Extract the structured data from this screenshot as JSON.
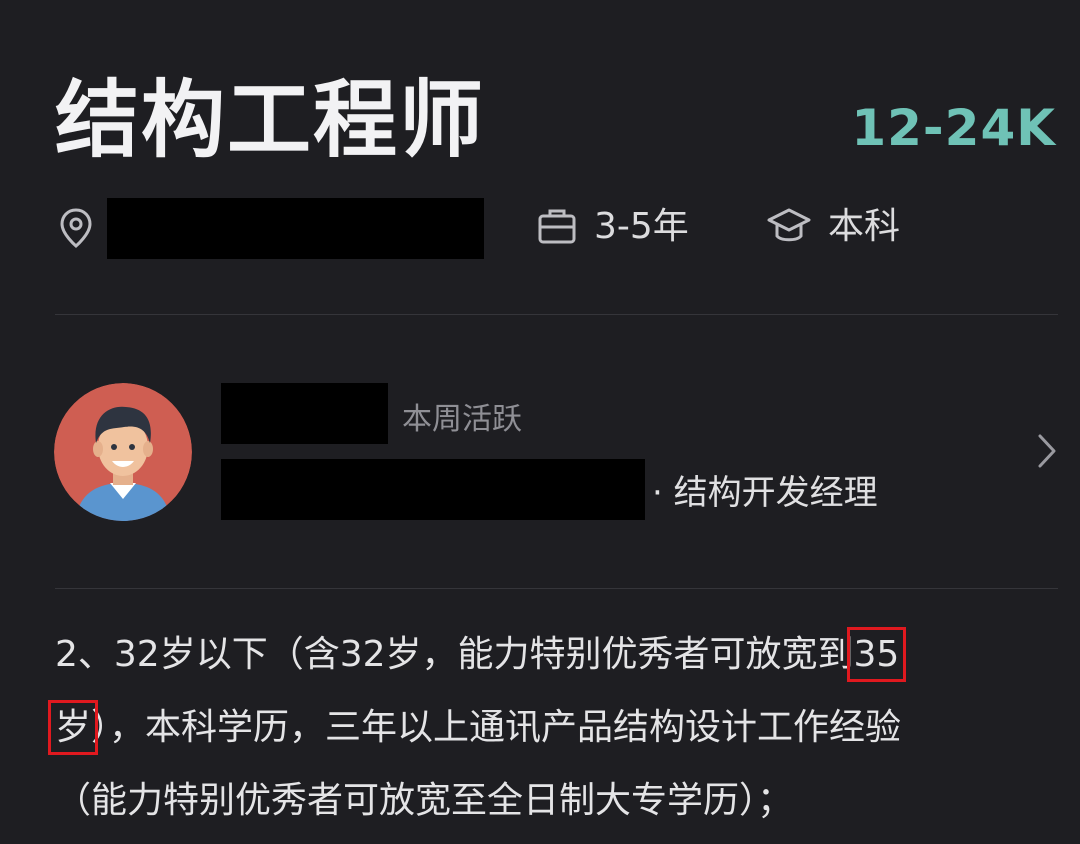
{
  "job": {
    "title": "结构工程师",
    "salary": "12-24K",
    "experience": "3-5年",
    "education": "本科"
  },
  "recruiter": {
    "status": "本周活跃",
    "position_suffix": "· 结构开发经理"
  },
  "description": {
    "line1_prefix": "2、32岁以下（含32岁，能力特别优秀者可放宽到",
    "highlight1": "35",
    "highlight2": "岁",
    "line2_suffix": "），本科学历，三年以上通讯产品结构设计工作经验",
    "line3": "（能力特别优秀者可放宽至全日制大专学历）；"
  },
  "icons": {
    "location": "location-pin-icon",
    "experience": "briefcase-icon",
    "education": "graduation-cap-icon",
    "chevron": "chevron-right-icon"
  },
  "colors": {
    "background": "#1e1e22",
    "salary": "#6fc2b6",
    "highlight_box": "#e0191f"
  }
}
